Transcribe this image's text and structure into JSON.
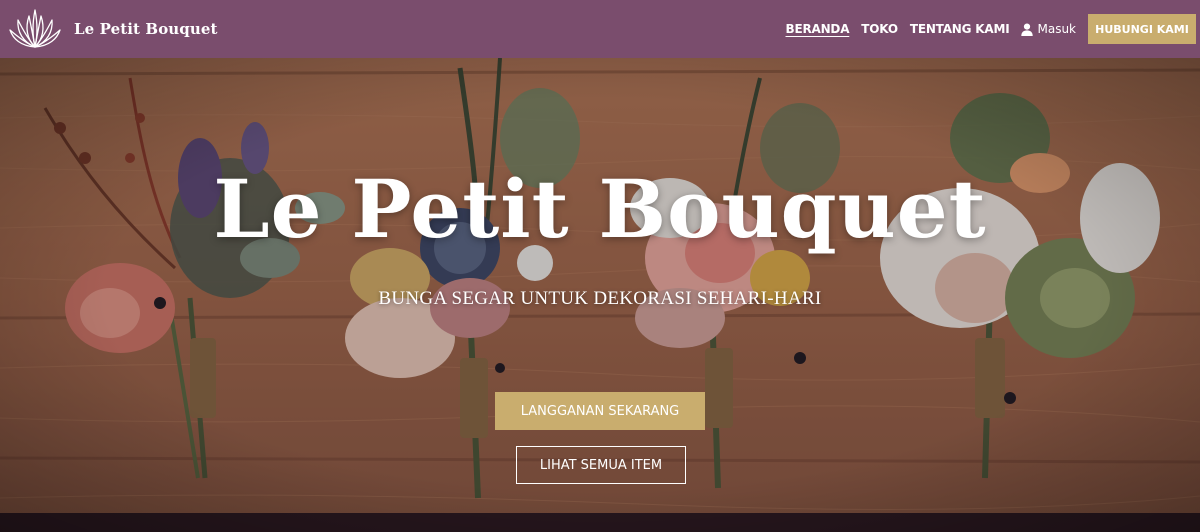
{
  "brand": {
    "name": "Le Petit Bouquet",
    "logo_icon": "lotus-logo-icon"
  },
  "nav": {
    "items": [
      {
        "label": "BERANDA",
        "active": true
      },
      {
        "label": "TOKO",
        "active": false
      },
      {
        "label": "TENTANG KAMI",
        "active": false
      }
    ],
    "login_label": "Masuk",
    "login_icon": "user-icon",
    "contact_label": "HUBUNGI KAMI"
  },
  "hero": {
    "title": "Le Petit Bouquet",
    "subtitle": "BUNGA SEGAR UNTUK DEKORASI SEHARI-HARI",
    "primary_cta": "LANGGANAN SEKARANG",
    "secondary_cta": "LIHAT SEMUA ITEM"
  },
  "colors": {
    "navbar_bg": "#7a4d6d",
    "accent": "#c9ad6e",
    "wood": "#a0664a",
    "text_light": "#ffffff"
  }
}
